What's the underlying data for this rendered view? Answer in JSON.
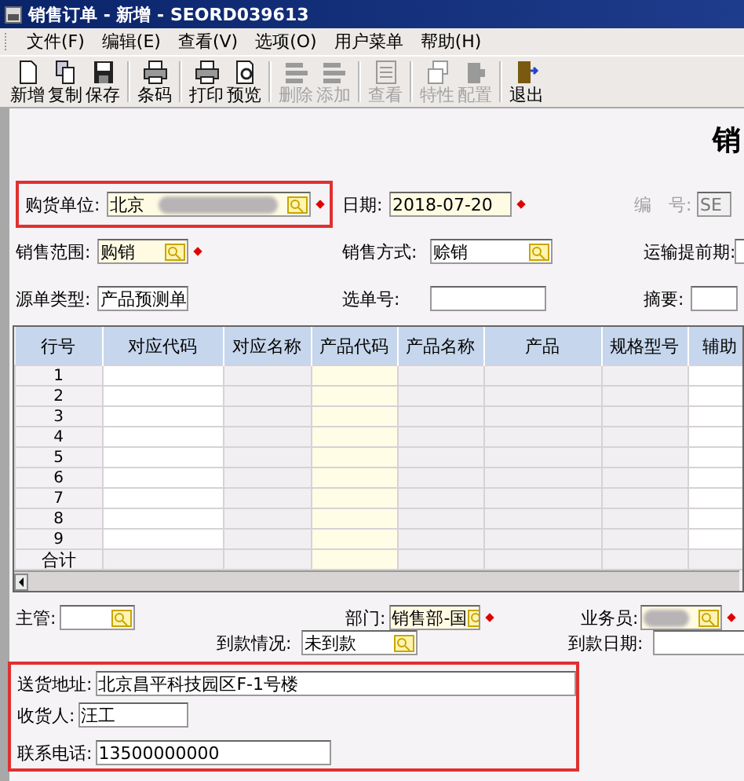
{
  "window": {
    "title": "销售订单 - 新增 - SEORD039613"
  },
  "menu": [
    {
      "label": "文件(F)"
    },
    {
      "label": "编辑(E)"
    },
    {
      "label": "查看(V)"
    },
    {
      "label": "选项(O)"
    },
    {
      "label": "用户菜单"
    },
    {
      "label": "帮助(H)"
    }
  ],
  "toolbar": [
    [
      {
        "label": "新增",
        "disabled": false
      },
      {
        "label": "复制",
        "disabled": false
      },
      {
        "label": "保存",
        "disabled": false
      }
    ],
    [
      {
        "label": "条码",
        "disabled": false
      }
    ],
    [
      {
        "label": "打印",
        "disabled": false
      },
      {
        "label": "预览",
        "disabled": false
      }
    ],
    [
      {
        "label": "删除",
        "disabled": true
      },
      {
        "label": "添加",
        "disabled": true
      }
    ],
    [
      {
        "label": "查看",
        "disabled": true
      }
    ],
    [
      {
        "label": "特性",
        "disabled": true
      },
      {
        "label": "配置",
        "disabled": true
      }
    ],
    [
      {
        "label": "退出",
        "disabled": false
      }
    ]
  ],
  "form_title": "销",
  "header_fields": [
    [
      {
        "label": "购货单位:",
        "value": "北京",
        "kind": "lookup",
        "required": true,
        "blurred": true,
        "highlighted": true,
        "disabled": false
      },
      {
        "label": "日期:",
        "value": "2018-07-20",
        "kind": "date",
        "required": true,
        "blurred": false,
        "highlighted": false,
        "disabled": false
      },
      {
        "label": "编　号:",
        "value": "SE",
        "kind": "text",
        "required": false,
        "blurred": false,
        "highlighted": false,
        "disabled": true
      }
    ],
    [
      {
        "label": "销售范围:",
        "value": "购销",
        "kind": "lookup",
        "required": true,
        "blurred": false,
        "highlighted": false,
        "disabled": false
      },
      {
        "label": "销售方式:",
        "value": "赊销",
        "kind": "lookup",
        "required": false,
        "blurred": false,
        "highlighted": false,
        "disabled": false
      },
      {
        "label": "运输提前期:",
        "kind": "text",
        "required": false,
        "blurred": false,
        "highlighted": false,
        "disabled": false
      }
    ],
    [
      {
        "label": "源单类型:",
        "value": "产品预测单",
        "kind": "text",
        "required": false,
        "blurred": false,
        "highlighted": false,
        "disabled": false
      },
      {
        "label": "选单号:",
        "kind": "text",
        "required": false,
        "blurred": false,
        "highlighted": false,
        "disabled": false
      },
      {
        "label": "摘要:",
        "kind": "text",
        "required": false,
        "blurred": false,
        "highlighted": false,
        "disabled": false
      }
    ]
  ],
  "table": {
    "columns": [
      {
        "label": "行号",
        "kind": "index"
      },
      {
        "label": "对应代码",
        "kind": "entry"
      },
      {
        "label": "对应名称",
        "kind": "readonly"
      },
      {
        "label": "产品代码",
        "kind": "required"
      },
      {
        "label": "产品名称",
        "kind": "readonly"
      },
      {
        "label": "产品",
        "kind": "readonly"
      },
      {
        "label": "规格型号",
        "kind": "readonly"
      },
      {
        "label": "辅助",
        "kind": "entry"
      }
    ],
    "rows": [
      "1",
      "2",
      "3",
      "4",
      "5",
      "6",
      "7",
      "8",
      "9"
    ],
    "total_label": "合计"
  },
  "footer_fields": [
    [
      {
        "label": "主管:",
        "kind": "lookup",
        "required": false,
        "blurred": false
      },
      {
        "label": "部门:",
        "value": "销售部-国",
        "kind": "lookup",
        "required": true,
        "blurred": false
      },
      {
        "label": "业务员:",
        "kind": "lookup",
        "required": true,
        "blurred": true
      }
    ],
    [
      {
        "label": "到款情况:",
        "value": "未到款",
        "kind": "lookup",
        "required": false,
        "blurred": false
      },
      {
        "label": "到款日期:",
        "kind": "text",
        "required": false,
        "blurred": false
      }
    ]
  ],
  "delivery": {
    "highlighted": true,
    "fields": [
      {
        "label": "送货地址:",
        "value": "北京昌平科技园区F-1号楼"
      },
      {
        "label": "收货人:",
        "value": "汪工"
      },
      {
        "label": "联系电话:",
        "value": "13500000000"
      }
    ]
  }
}
